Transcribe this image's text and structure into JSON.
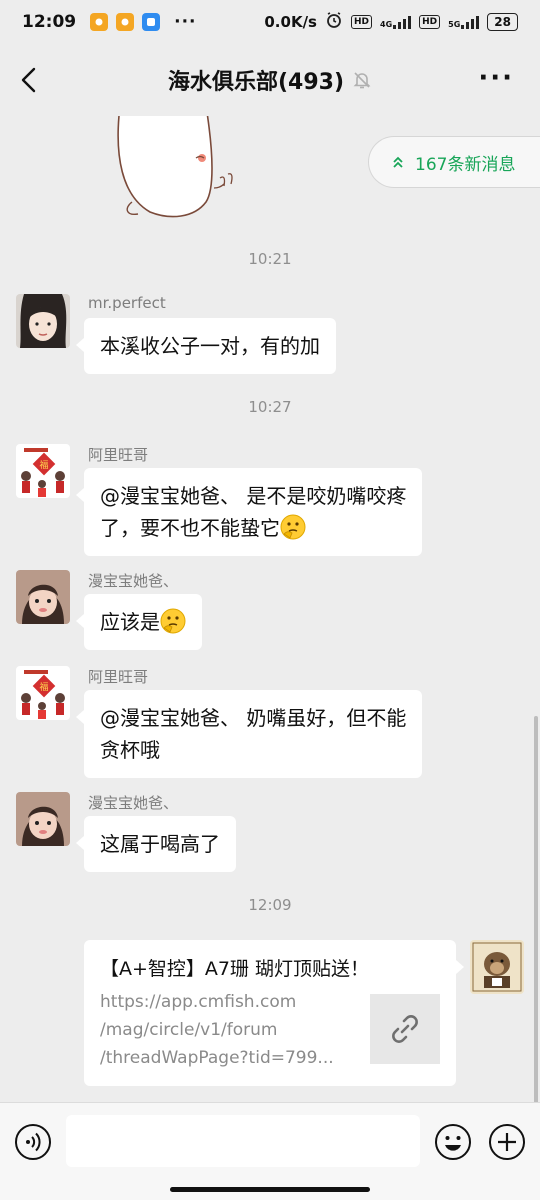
{
  "status_bar": {
    "time": "12:09",
    "more": "···",
    "speed": "0.0K/s",
    "hd1": "HD",
    "net1": "4G",
    "hd2": "HD",
    "net2": "5G",
    "battery": "28",
    "app_icon_colors": [
      "#f4a623",
      "#f4a623",
      "#2f8cf0"
    ]
  },
  "header": {
    "title": "海水俱乐部(493)",
    "back_icon": "chevron-left-icon",
    "mute_icon": "bell-off-icon",
    "more_label": "···"
  },
  "new_messages_pill": {
    "label": "167条新消息",
    "color": "#18a558"
  },
  "timestamps": [
    "10:21",
    "10:27",
    "12:09"
  ],
  "messages": [
    {
      "sender": "mr.perfect",
      "text": "本溪收公子一对，有的加"
    },
    {
      "sender": "阿里旺哥",
      "line1": "@漫宝宝她爸、 是不是咬奶嘴咬疼",
      "line2": "了，要不也不能蛰它"
    },
    {
      "sender": "漫宝宝她爸、",
      "text": "应该是"
    },
    {
      "sender": "阿里旺哥",
      "line1": "@漫宝宝她爸、 奶嘴虽好，但不能",
      "line2": "贪杯哦"
    },
    {
      "sender": "漫宝宝她爸、",
      "text": "这属于喝高了"
    }
  ],
  "link_card": {
    "title": "【A+智控】A7珊 瑚灯顶贴送！",
    "url_line1": "https://app.cmfish.com",
    "url_line2": "/mag/circle/v1/forum",
    "url_line3": "/threadWapPage?tid=799...",
    "thumb_icon": "link-icon"
  },
  "input_bar": {
    "voice_icon": "voice-icon",
    "emoji_icon": "smile-icon",
    "plus_icon": "plus-icon",
    "placeholder": ""
  }
}
